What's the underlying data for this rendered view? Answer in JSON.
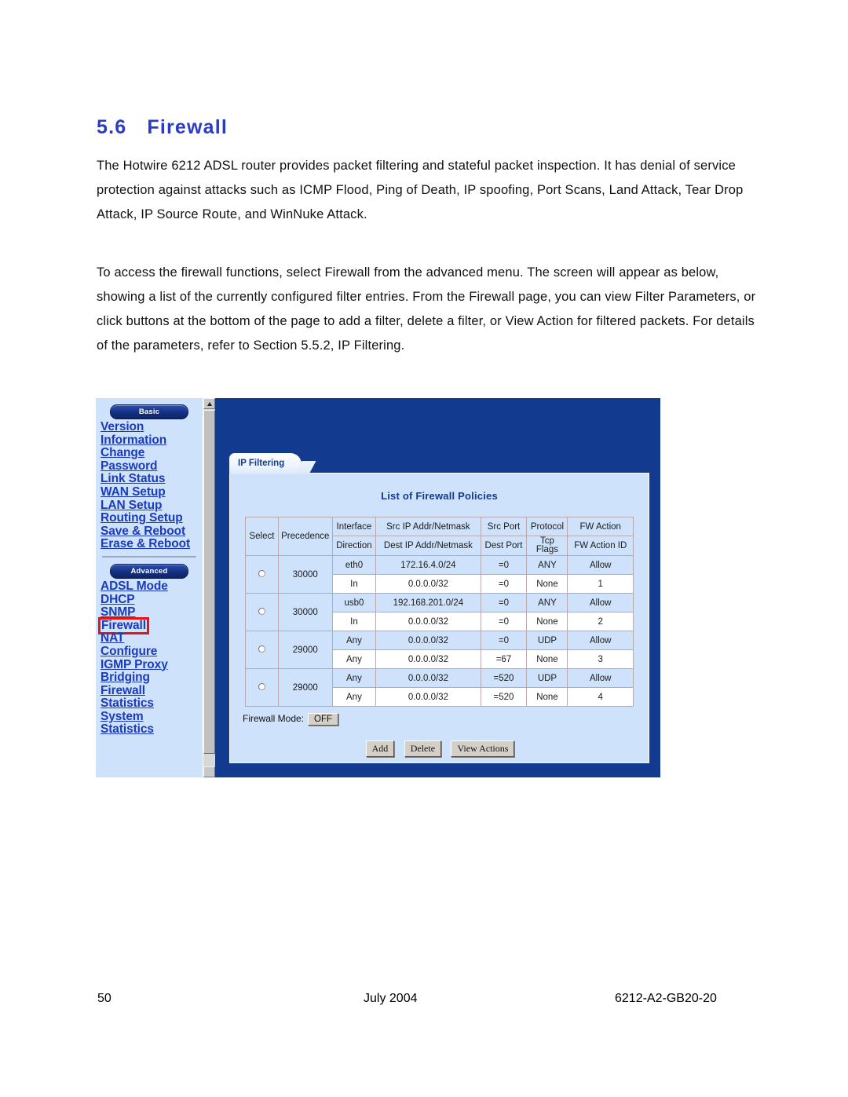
{
  "document": {
    "section_number": "5.6",
    "section_title": "Firewall",
    "paragraph_1": "The Hotwire 6212 ADSL router provides packet filtering and stateful packet inspection. It has denial of service protection against attacks such as ICMP Flood, Ping of Death, IP spoofing, Port Scans, Land Attack, Tear Drop Attack, IP Source Route, and WinNuke Attack.",
    "paragraph_2": "To access the firewall functions, select Firewall from the advanced menu. The screen will appear as below, showing a list of the currently configured filter entries. From the Firewall page, you can view Filter Parameters, or click buttons at the bottom of the page to add a filter, delete a filter, or View Action for filtered packets. For details of the parameters, refer to Section 5.5.2, IP Filtering."
  },
  "footer": {
    "page_number": "50",
    "date": "July 2004",
    "doc_number": "6212-A2-GB20-20"
  },
  "router_ui": {
    "sidebar": {
      "basic_label": "Basic",
      "advanced_label": "Advanced",
      "basic_items": [
        "Version\nInformation",
        "Change\nPassword",
        "Link Status",
        "WAN Setup",
        "LAN Setup",
        "Routing Setup",
        "Save & Reboot",
        "Erase & Reboot"
      ],
      "advanced_items": [
        "ADSL Mode",
        "DHCP",
        "SNMP",
        "Firewall",
        "NAT",
        "Configure",
        "IGMP Proxy",
        "Bridging",
        "Firewall\nStatistics",
        "System\nStatistics"
      ],
      "highlighted_item": "Firewall",
      "highlight_color": "#ee1111"
    },
    "tab_label": "IP Filtering",
    "panel_title": "List of Firewall Policies",
    "table": {
      "headers": {
        "select": "Select",
        "precedence": "Precedence",
        "row1": [
          "Interface",
          "Src IP Addr/Netmask",
          "Src Port",
          "Protocol",
          "FW Action"
        ],
        "row2": [
          "Direction",
          "Dest IP Addr/Netmask",
          "Dest Port",
          "Tcp\nFlags",
          "FW Action ID"
        ]
      },
      "rows": [
        {
          "precedence": "30000",
          "interface": "eth0",
          "src_addr": "172.16.4.0/24",
          "src_port": "=0",
          "protocol": "ANY",
          "fw_action": "Allow",
          "direction": "In",
          "dest_addr": "0.0.0.0/32",
          "dest_port": "=0",
          "tcp_flags": "None",
          "fw_action_id": "1"
        },
        {
          "precedence": "30000",
          "interface": "usb0",
          "src_addr": "192.168.201.0/24",
          "src_port": "=0",
          "protocol": "ANY",
          "fw_action": "Allow",
          "direction": "In",
          "dest_addr": "0.0.0.0/32",
          "dest_port": "=0",
          "tcp_flags": "None",
          "fw_action_id": "2"
        },
        {
          "precedence": "29000",
          "interface": "Any",
          "src_addr": "0.0.0.0/32",
          "src_port": "=0",
          "protocol": "UDP",
          "fw_action": "Allow",
          "direction": "Any",
          "dest_addr": "0.0.0.0/32",
          "dest_port": "=67",
          "tcp_flags": "None",
          "fw_action_id": "3"
        },
        {
          "precedence": "29000",
          "interface": "Any",
          "src_addr": "0.0.0.0/32",
          "src_port": "=520",
          "protocol": "UDP",
          "fw_action": "Allow",
          "direction": "Any",
          "dest_addr": "0.0.0.0/32",
          "dest_port": "=520",
          "tcp_flags": "None",
          "fw_action_id": "4"
        }
      ]
    },
    "firewall_mode_label": "Firewall Mode:",
    "firewall_mode_value": "OFF",
    "buttons": [
      "Add",
      "Delete",
      "View Actions"
    ],
    "colors": {
      "panel_blue": "#123a8e",
      "light_blue": "#cfe2fb",
      "link_blue": "#1b3bbb"
    }
  }
}
